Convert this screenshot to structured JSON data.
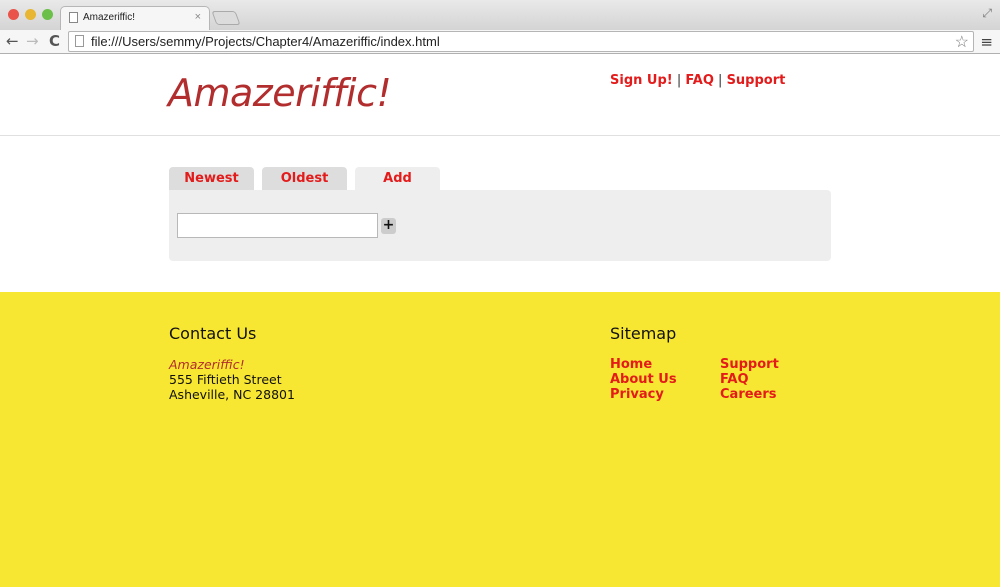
{
  "browser": {
    "tab_title": "Amazeriffic!",
    "tab_close": "×",
    "url": "file:///Users/semmy/Projects/Chapter4/Amazeriffic/index.html",
    "back": "←",
    "forward": "→",
    "reload": "C",
    "star": "☆",
    "menu": "≡",
    "resize": "⤢"
  },
  "header": {
    "logo": "Amazeriffic!",
    "nav": [
      {
        "label": "Sign Up!"
      },
      {
        "label": "FAQ"
      },
      {
        "label": "Support"
      }
    ],
    "separator": "|"
  },
  "main": {
    "tabs": [
      {
        "label": "Newest",
        "active": false
      },
      {
        "label": "Oldest",
        "active": false
      },
      {
        "label": "Add",
        "active": true
      }
    ],
    "input_value": "",
    "add_button": "+"
  },
  "footer": {
    "contact": {
      "title": "Contact Us",
      "name": "Amazeriffic!",
      "street": "555 Fiftieth Street",
      "city": "Asheville, NC 28801"
    },
    "sitemap": {
      "title": "Sitemap",
      "col1": [
        {
          "label": "Home"
        },
        {
          "label": "About Us"
        },
        {
          "label": "Privacy"
        }
      ],
      "col2": [
        {
          "label": "Support"
        },
        {
          "label": "FAQ"
        },
        {
          "label": "Careers"
        }
      ]
    }
  },
  "colors": {
    "brand": "#b22d2d",
    "link": "#e31b1b",
    "footer_bg": "#f8e732",
    "panel_bg": "#eeeeee"
  }
}
